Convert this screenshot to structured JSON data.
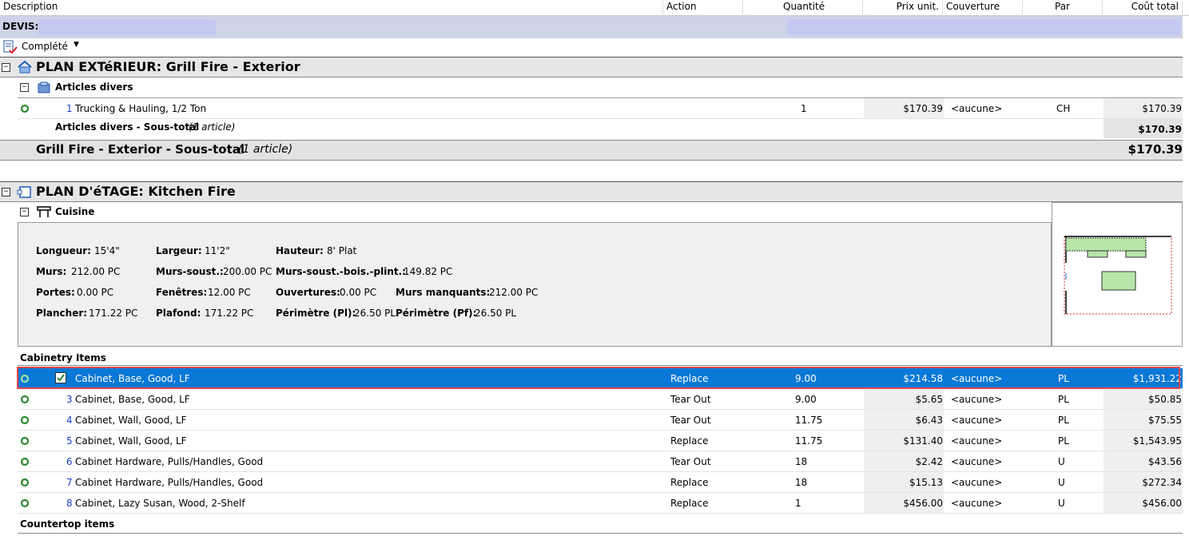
{
  "columns": {
    "description": "Description",
    "action": "Action",
    "quantity": "Quantité",
    "unit_price": "Prix unit.",
    "coverage": "Couverture",
    "per": "Par",
    "total_cost": "Coût total"
  },
  "devis": {
    "label": "DEVIS:"
  },
  "status": {
    "label": "Complété"
  },
  "plan_exterior": {
    "title": "PLAN EXTéRIEUR: Grill Fire - Exterior",
    "room_title": "Articles divers",
    "item": {
      "num": "1",
      "desc": "Trucking & Hauling, 1/2 Ton",
      "qty": "1",
      "price": "$170.39",
      "coverage": "<aucune>",
      "per": "CH",
      "total": "$170.39"
    },
    "room_subtotal_label": "Articles divers - Sous-total",
    "room_subtotal_count": "(1 article)",
    "room_subtotal_value": "$170.39",
    "plan_subtotal_label": "Grill Fire - Exterior - Sous-total",
    "plan_subtotal_count": "(1 article)",
    "plan_subtotal_value": "$170.39"
  },
  "plan_floor": {
    "title": "PLAN D'éTAGE: Kitchen Fire",
    "room_title": "Cuisine"
  },
  "dimensions": {
    "longueur_k": "Longueur:",
    "longueur_v": "15'4\"",
    "largeur_k": "Largeur:",
    "largeur_v": "11'2\"",
    "hauteur_k": "Hauteur:",
    "hauteur_v": "8' Plat",
    "murs_k": "Murs:",
    "murs_v": "212.00 PC",
    "murs_sous_k": "Murs-soust.:",
    "murs_sous_v": "200.00 PC",
    "murs_bois_k": "Murs-soust.-bois.-plint.:",
    "murs_bois_v": "149.82 PC",
    "portes_k": "Portes:",
    "portes_v": "0.00 PC",
    "fenetres_k": "Fenêtres:",
    "fenetres_v": "12.00 PC",
    "ouvertures_k": "Ouvertures:",
    "ouvertures_v": "0.00 PC",
    "murs_manq_k": "Murs manquants:",
    "murs_manq_v": "212.00 PC",
    "plancher_k": "Plancher:",
    "plancher_v": "171.22 PC",
    "plafond_k": "Plafond:",
    "plafond_v": "171.22 PC",
    "perim_pl_k": "Périmètre (Pl):",
    "perim_pl_v": "26.50 PL",
    "perim_pf_k": "Périmètre (Pf):",
    "perim_pf_v": "26.50 PL"
  },
  "cabinetry_label": "Cabinetry Items",
  "countertop_label": "Countertop items",
  "items": [
    {
      "num": "",
      "desc": "Cabinet, Base, Good, LF",
      "action": "Replace",
      "qty": "9.00",
      "price": "$214.58",
      "coverage": "<aucune>",
      "per": "PL",
      "total": "$1,931.22"
    },
    {
      "num": "3",
      "desc": "Cabinet, Base, Good, LF",
      "action": "Tear Out",
      "qty": "9.00",
      "price": "$5.65",
      "coverage": "<aucune>",
      "per": "PL",
      "total": "$50.85"
    },
    {
      "num": "4",
      "desc": "Cabinet, Wall, Good, LF",
      "action": "Tear Out",
      "qty": "11.75",
      "price": "$6.43",
      "coverage": "<aucune>",
      "per": "PL",
      "total": "$75.55"
    },
    {
      "num": "5",
      "desc": "Cabinet, Wall, Good, LF",
      "action": "Replace",
      "qty": "11.75",
      "price": "$131.40",
      "coverage": "<aucune>",
      "per": "PL",
      "total": "$1,543.95"
    },
    {
      "num": "6",
      "desc": "Cabinet Hardware, Pulls/Handles, Good",
      "action": "Tear Out",
      "qty": "18",
      "price": "$2.42",
      "coverage": "<aucune>",
      "per": "U",
      "total": "$43.56"
    },
    {
      "num": "7",
      "desc": "Cabinet Hardware, Pulls/Handles, Good",
      "action": "Replace",
      "qty": "18",
      "price": "$15.13",
      "coverage": "<aucune>",
      "per": "U",
      "total": "$272.34"
    },
    {
      "num": "8",
      "desc": "Cabinet, Lazy Susan, Wood, 2-Shelf",
      "action": "Replace",
      "qty": "1",
      "price": "$456.00",
      "coverage": "<aucune>",
      "per": "U",
      "total": "$456.00"
    }
  ],
  "colors": {
    "selection": "#0a78d7",
    "highlight_border": "#e04848",
    "link_number": "#1a3fc8",
    "devis_bg": "#cdd3e8"
  }
}
